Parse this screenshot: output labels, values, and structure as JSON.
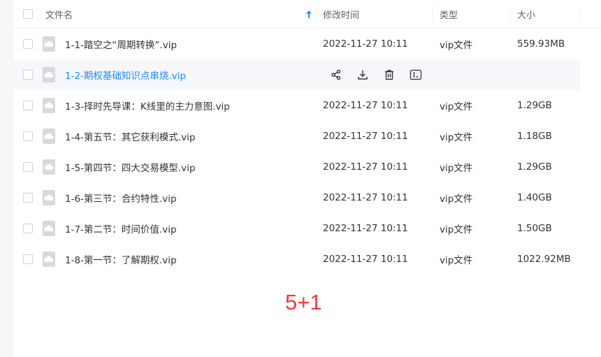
{
  "header": {
    "name": "文件名",
    "modified": "修改时间",
    "type": "类型",
    "size": "大小"
  },
  "colors": {
    "link": "#1f8bff",
    "sort_arrow": "#1f8bff",
    "annotation": "#f03a3a",
    "file_icon": "#d6d9de"
  },
  "files": [
    {
      "name": "1-1-踏空之“周期转换”.vip",
      "modified": "2022-11-27 10:11",
      "type": "vip文件",
      "size": "559.93MB"
    },
    {
      "name": "1-2-期权基础知识点串烧.vip",
      "modified": "",
      "type": "",
      "size": ""
    },
    {
      "name": "1-3-择时先导课：K线里的主力意图.vip",
      "modified": "2022-11-27 10:11",
      "type": "vip文件",
      "size": "1.29GB"
    },
    {
      "name": "1-4-第五节：其它获利模式.vip",
      "modified": "2022-11-27 10:11",
      "type": "vip文件",
      "size": "1.18GB"
    },
    {
      "name": "1-5-第四节：四大交易模型.vip",
      "modified": "2022-11-27 10:11",
      "type": "vip文件",
      "size": "1.29GB"
    },
    {
      "name": "1-6-第三节：合约特性.vip",
      "modified": "2022-11-27 10:11",
      "type": "vip文件",
      "size": "1.40GB"
    },
    {
      "name": "1-7-第二节：时间价值.vip",
      "modified": "2022-11-27 10:11",
      "type": "vip文件",
      "size": "1.50GB"
    },
    {
      "name": "1-8-第一节：了解期权.vip",
      "modified": "2022-11-27 10:11",
      "type": "vip文件",
      "size": "1022.92MB"
    }
  ],
  "hover_actions": [
    "share-icon",
    "download-icon",
    "delete-icon",
    "rename-icon"
  ],
  "annotation": "5+1"
}
